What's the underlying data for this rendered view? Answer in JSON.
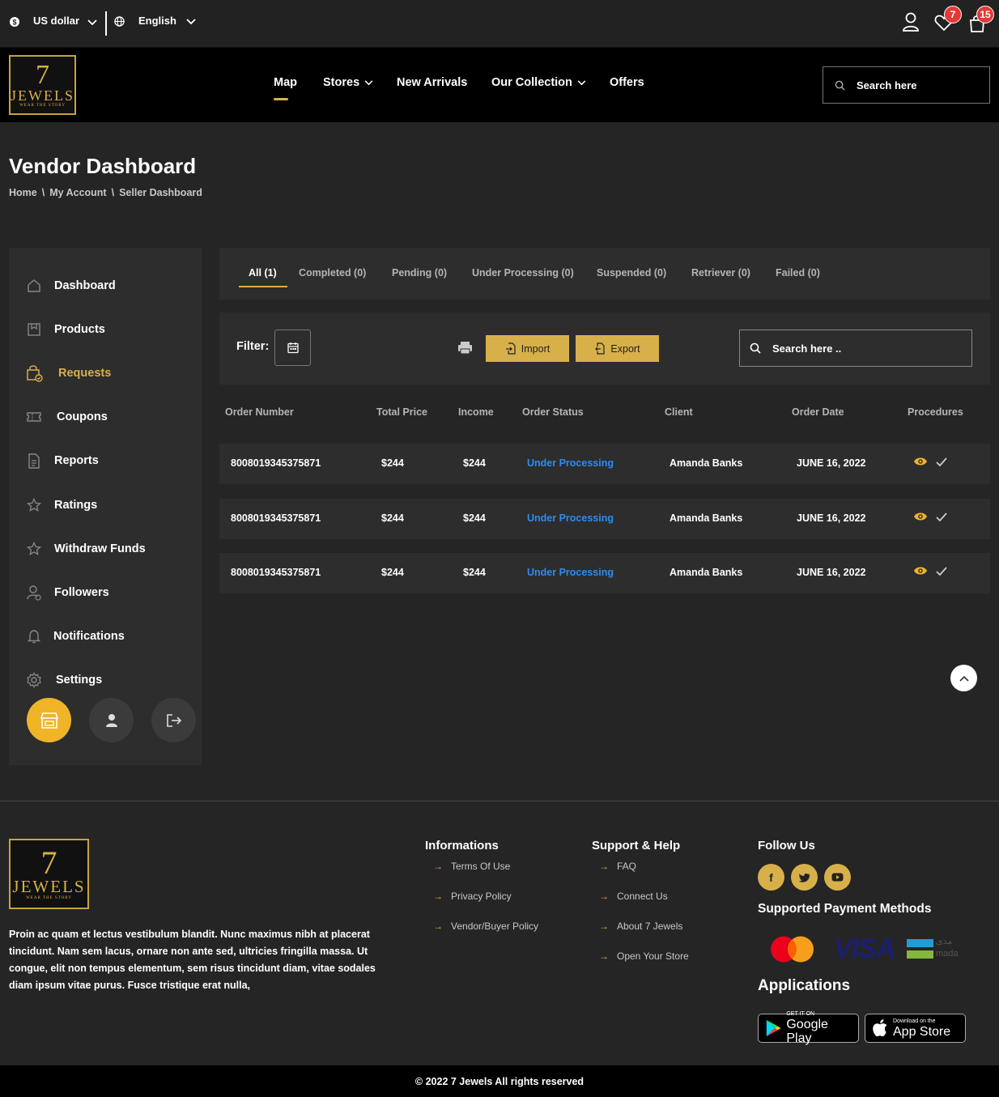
{
  "topbar": {
    "currency": "US dollar",
    "language": "English",
    "wishlist_count": "7",
    "cart_count": "15"
  },
  "brand": {
    "logo_seven": "7",
    "logo_word": "JEWELS",
    "logo_tagline": "WEAR THE STORY"
  },
  "nav": {
    "items": [
      {
        "label": "Map"
      },
      {
        "label": "Stores"
      },
      {
        "label": "New Arrivals"
      },
      {
        "label": "Our Collection"
      },
      {
        "label": "Offers"
      }
    ],
    "search_placeholder": "Search here"
  },
  "page": {
    "title": "Vendor Dashboard",
    "breadcrumb": [
      "Home",
      "My Account",
      "Seller Dashboard"
    ],
    "breadcrumb_sep": "\\"
  },
  "sidebar": {
    "items": [
      {
        "label": "Dashboard",
        "icon": "home-icon"
      },
      {
        "label": "Products",
        "icon": "product-icon"
      },
      {
        "label": "Requests",
        "icon": "shopping-bag-icon",
        "active": true
      },
      {
        "label": "Coupons",
        "icon": "coupon-icon"
      },
      {
        "label": "Reports",
        "icon": "report-icon"
      },
      {
        "label": "Ratings",
        "icon": "star-icon"
      },
      {
        "label": "Withdraw Funds",
        "icon": "star-icon"
      },
      {
        "label": "Followers",
        "icon": "followers-icon"
      },
      {
        "label": "Notifications",
        "icon": "bell-icon"
      },
      {
        "label": "Settings",
        "icon": "gear-icon"
      }
    ],
    "bottom_buttons": [
      "store-icon",
      "user-icon",
      "logout-icon"
    ]
  },
  "tabs": [
    {
      "label": "All (1)",
      "active": true
    },
    {
      "label": "Completed (0)"
    },
    {
      "label": "Pending (0)"
    },
    {
      "label": "Under Processing (0)"
    },
    {
      "label": "Suspended (0)"
    },
    {
      "label": "Retriever (0)"
    },
    {
      "label": "Failed (0)"
    }
  ],
  "filter": {
    "label": "Filter:",
    "import_label": "Import",
    "export_label": "Export",
    "search_placeholder": "Search here .."
  },
  "table": {
    "headers": [
      "Order Number",
      "Total Price",
      "Income",
      "Order Status",
      "Client",
      "Order Date",
      "Procedures"
    ],
    "rows": [
      {
        "order": "8008019345375871",
        "total": "$244",
        "income": "$244",
        "status": "Under Processing",
        "client": "Amanda Banks",
        "date": "JUNE 16, 2022"
      },
      {
        "order": "8008019345375871",
        "total": "$244",
        "income": "$244",
        "status": "Under Processing",
        "client": "Amanda Banks",
        "date": "JUNE 16, 2022"
      },
      {
        "order": "8008019345375871",
        "total": "$244",
        "income": "$244",
        "status": "Under Processing",
        "client": "Amanda Banks",
        "date": "JUNE 16, 2022"
      }
    ]
  },
  "footer": {
    "description": "Proin ac quam et lectus vestibulum blandit. Nunc maximus nibh at placerat tincidunt. Nam sem lacus, ornare non ante sed, ultricies fringilla massa. Ut congue, elit non tempus elementum, sem risus tincidunt diam, vitae sodales diam ipsum vitae purus. Fusce tristique erat nulla,",
    "informations": {
      "title": "Informations",
      "links": [
        "Terms Of Use",
        "Privacy Policy",
        "Vendor/Buyer Policy"
      ]
    },
    "support": {
      "title": "Support & Help",
      "links": [
        "FAQ",
        "Connect Us",
        "About 7 Jewels",
        "Open Your Store"
      ]
    },
    "follow_title": "Follow Us",
    "social": [
      "facebook-icon",
      "twitter-icon",
      "youtube-icon"
    ],
    "payments_title": "Supported Payment Methods",
    "payment_visa": "VISA",
    "payment_mada_ar": "مدى",
    "payment_mada": "mada",
    "applications_title": "Applications",
    "google_play": {
      "small": "GET IT ON",
      "big": "Google Play"
    },
    "app_store": {
      "small": "Download on the",
      "big": "App Store"
    },
    "copyright": "© 2022 7 Jewels All rights reserved"
  },
  "colors": {
    "accent": "#d8b04a",
    "status_blue": "#2d8cf0",
    "badge_red": "#e53935"
  }
}
